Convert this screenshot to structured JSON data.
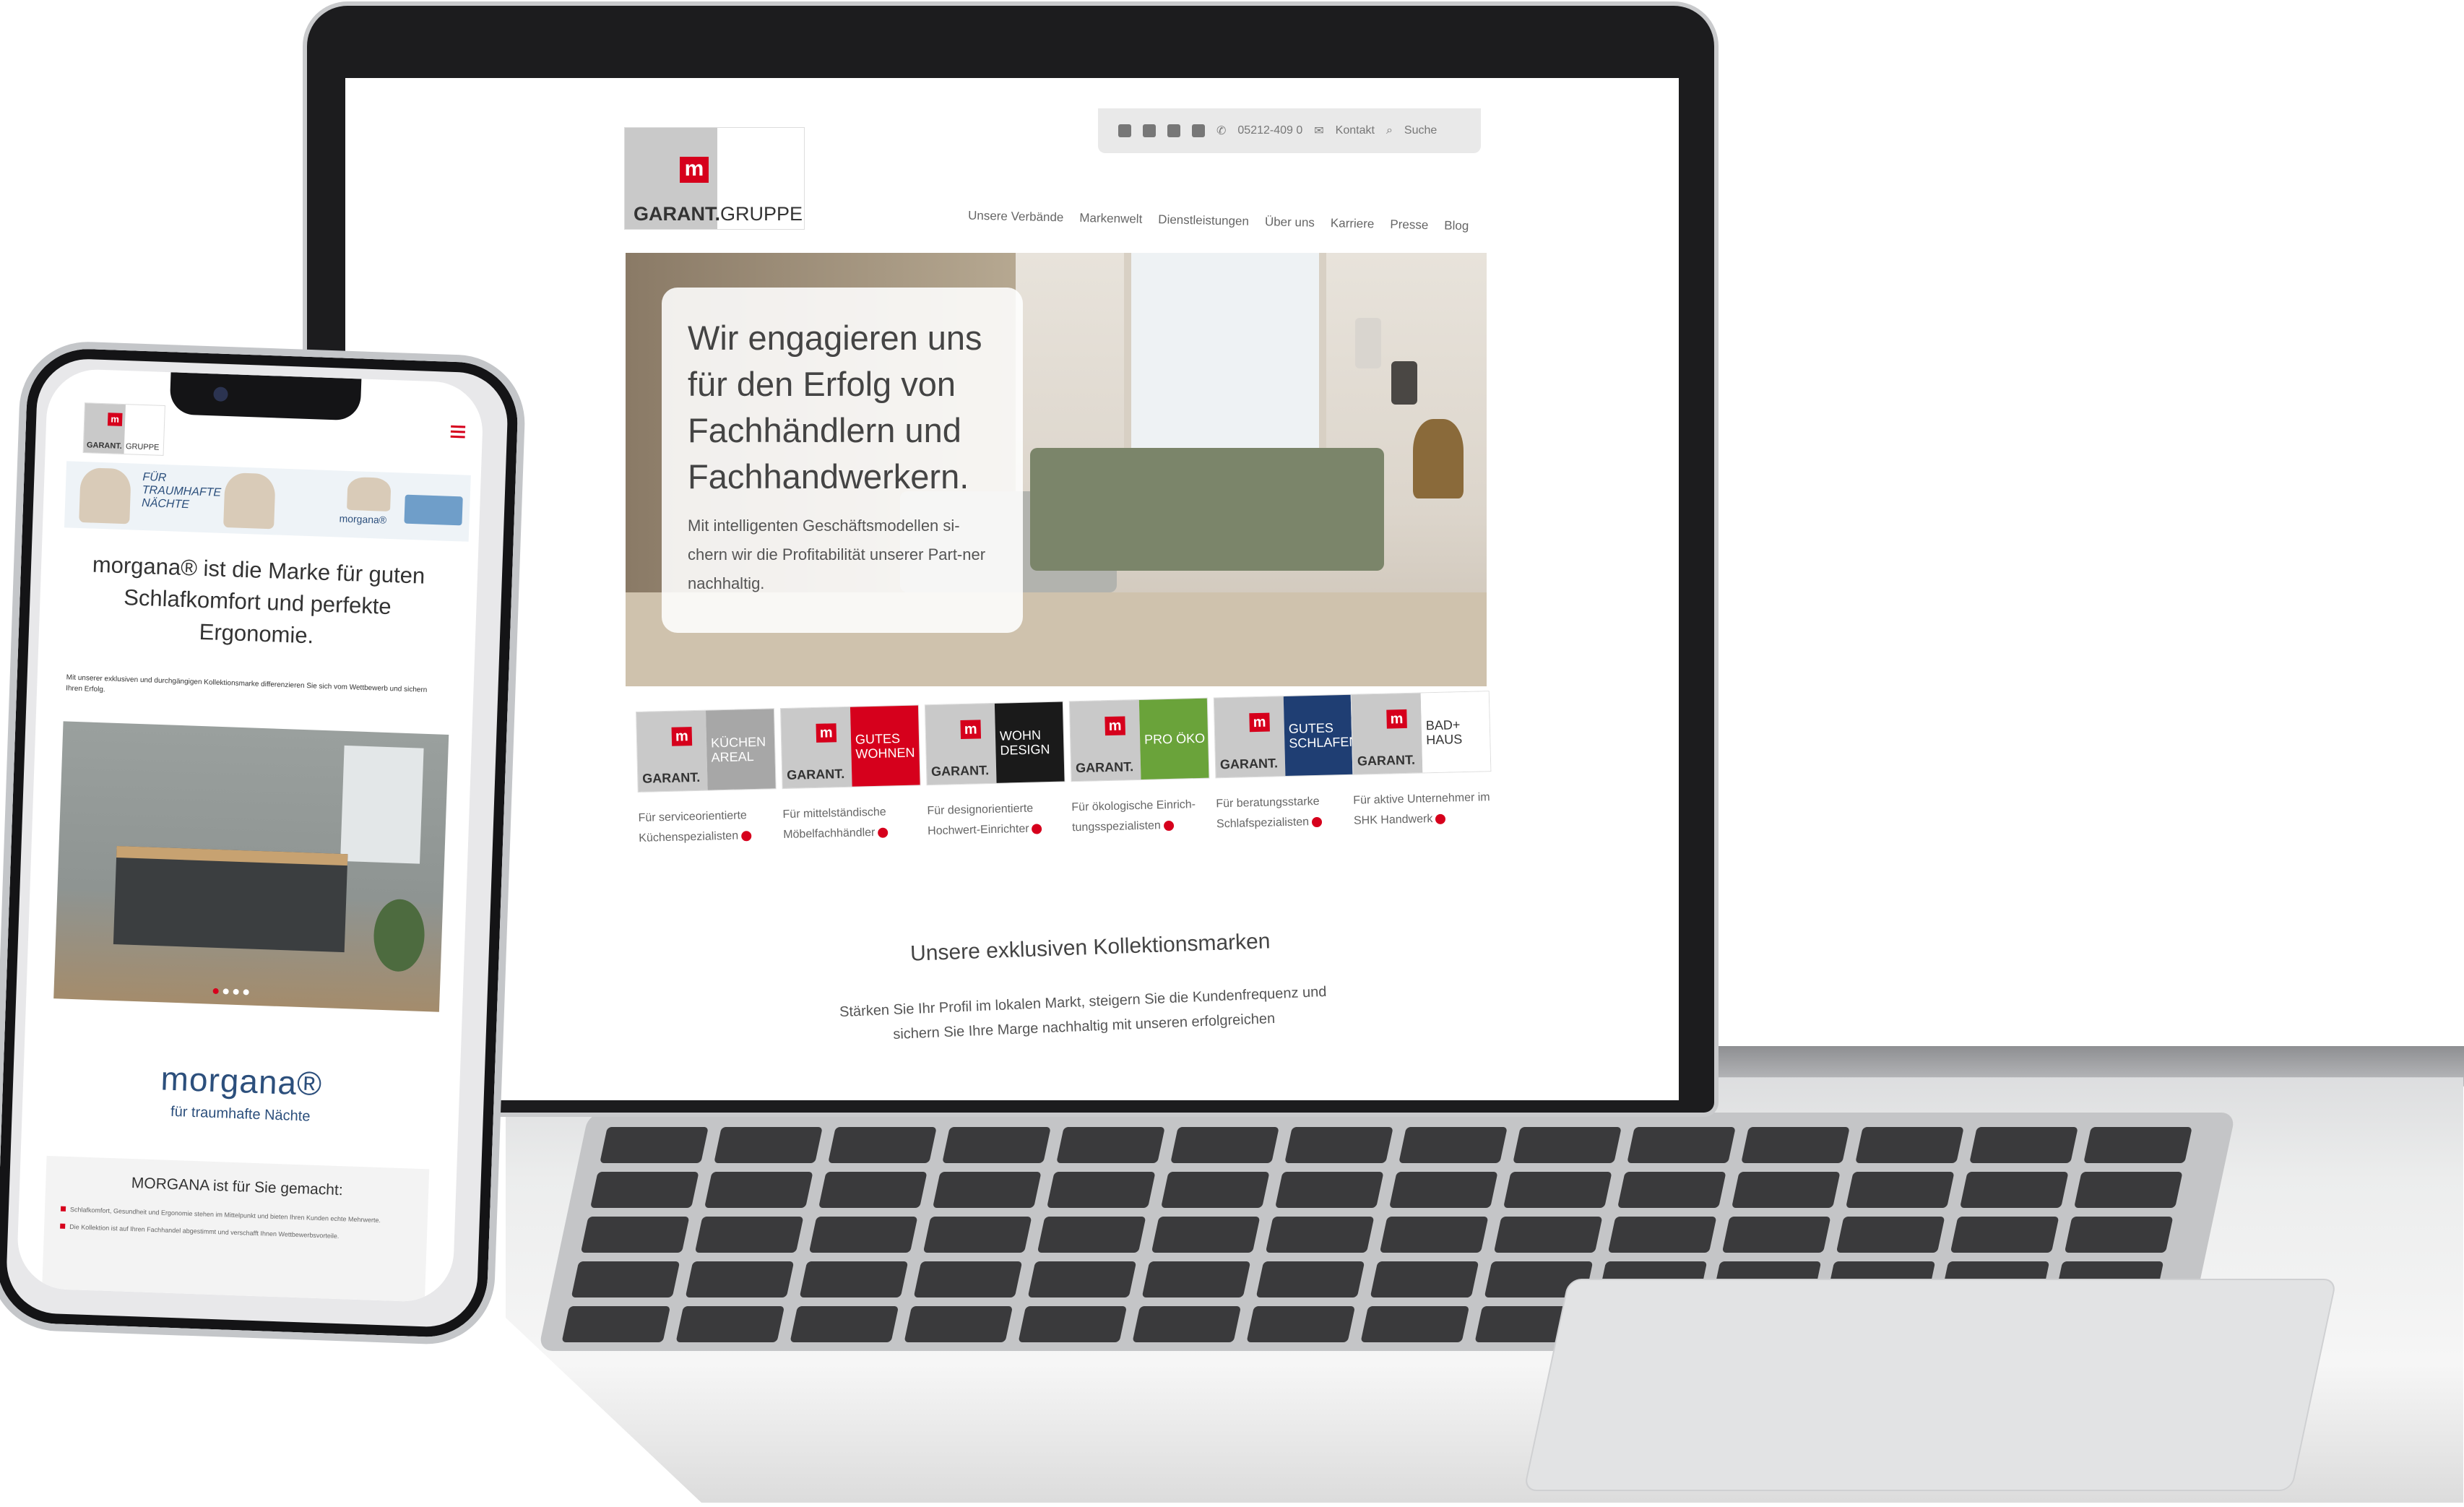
{
  "laptop_site": {
    "topbar": {
      "social_icons": [
        "facebook-icon",
        "x-icon",
        "linkedin-icon",
        "rss-icon"
      ],
      "phone": "05212-409 0",
      "contact": "Kontakt",
      "search": "Suche"
    },
    "logo": {
      "brand": "GARANT.",
      "suffix": "GRUPPE",
      "mark": "m"
    },
    "nav": [
      "Unsere Verbände",
      "Markenwelt",
      "Dienstleistungen",
      "Über uns",
      "Karriere",
      "Presse",
      "Blog"
    ],
    "hero": {
      "headline": "Wir engagieren uns für den Erfolg von Fachhändlern und Fachhandwerkern.",
      "text": "Mit intelligenten Geschäftsmodellen si-chern wir die Profitabilität unserer Part-ner nachhaltig."
    },
    "brands": [
      {
        "label": "KÜCHEN AREAL",
        "color": "#a7a7a7",
        "desc": "Für serviceorientierte Küchenspezialisten"
      },
      {
        "label": "GUTES WOHNEN",
        "color": "#d6001c",
        "desc": "Für mittelständische Möbelfachhändler"
      },
      {
        "label": "WOHN DESIGN",
        "color": "#1a1a1a",
        "desc": "Für designorientierte Hochwert-Einrichter"
      },
      {
        "label": "PRO ÖKO",
        "color": "#6aa33a",
        "desc": "Für ökologische Einrich-tungsspezialisten"
      },
      {
        "label": "GUTES SCHLAFEN",
        "color": "#1f3e73",
        "desc": "Für beratungsstarke Schlafspezialisten"
      },
      {
        "label": "BAD+ HAUS",
        "color": "#ffffff",
        "desc": "Für aktive Unternehmer im SHK Handwerk"
      }
    ],
    "brand_tile_text": "GARANT.",
    "section_title": "Unsere exklusiven Kollektionsmarken",
    "section_text": "Stärken Sie Ihr Profil im lokalen Markt, steigern Sie die Kundenfrequenz und sichern Sie Ihre Marge nachhaltig mit unseren erfolgreichen"
  },
  "phone_site": {
    "logo": {
      "brand": "GARANT.",
      "suffix": "GRUPPE",
      "mark": "m"
    },
    "banner": {
      "script": "FÜR TRAUMHAFTE NÄCHTE",
      "brand": "morgana®"
    },
    "headline": "morgana® ist die Marke für guten Schlafkomfort und perfekte Ergonomie.",
    "small_text": "Mit unserer exklusiven und durchgängigen Kollektionsmarke differenzieren Sie sich vom Wettbewerb und sichern Ihren Erfolg.",
    "brand_name": "morgana®",
    "brand_tagline": "für traumhafte Nächte",
    "box_title": "MORGANA ist für Sie gemacht:",
    "box_items": [
      "Schlafkomfort, Gesundheit und Ergonomie stehen im Mittelpunkt und bieten Ihren Kunden echte Mehrwerte.",
      "Die Kollektion ist auf Ihren Fachhandel abgestimmt und verschafft Ihnen Wettbewerbsvorteile."
    ]
  },
  "colors": {
    "accent_red": "#d6001c",
    "morgana_blue": "#2c4f7c",
    "laptop_bezel": "#1c1c1e"
  }
}
